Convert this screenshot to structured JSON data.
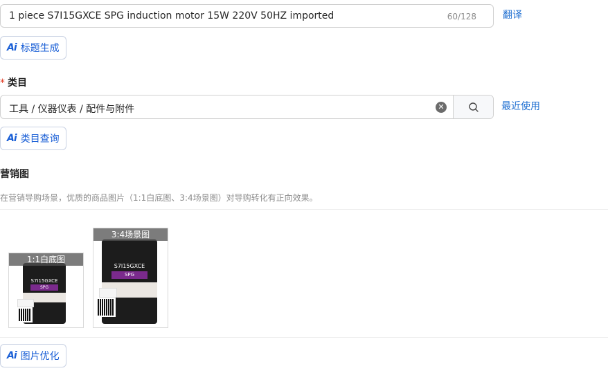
{
  "title_field": {
    "value": "1 piece S7I15GXCE SPG induction motor 15W 220V 50HZ imported",
    "counter": "60/128",
    "translate_link": "翻译"
  },
  "title_ai_button": {
    "icon_text": "Ai",
    "label": "标题生成"
  },
  "category": {
    "required_mark": "*",
    "label": "类目",
    "value": "工具 / 仪器仪表 / 配件与附件",
    "recent_link": "最近使用"
  },
  "category_ai_button": {
    "icon_text": "Ai",
    "label": "类目查询"
  },
  "marketing": {
    "label": "营销图",
    "hint": "在营销导购场景，优质的商品图片（1:1白底图、3:4场景图）对导购转化有正向效果。",
    "images": [
      {
        "tag": "1:1白底图",
        "model": "S7I15GXCE",
        "brand": "SPG"
      },
      {
        "tag": "3:4场景图",
        "model": "S7I15GXCE",
        "brand": "SPG"
      }
    ]
  },
  "image_ai_button": {
    "icon_text": "Ai",
    "label": "图片优化"
  },
  "colors": {
    "accent": "#1a5fd6",
    "link": "#1f6fd1",
    "required": "#e0321a"
  }
}
